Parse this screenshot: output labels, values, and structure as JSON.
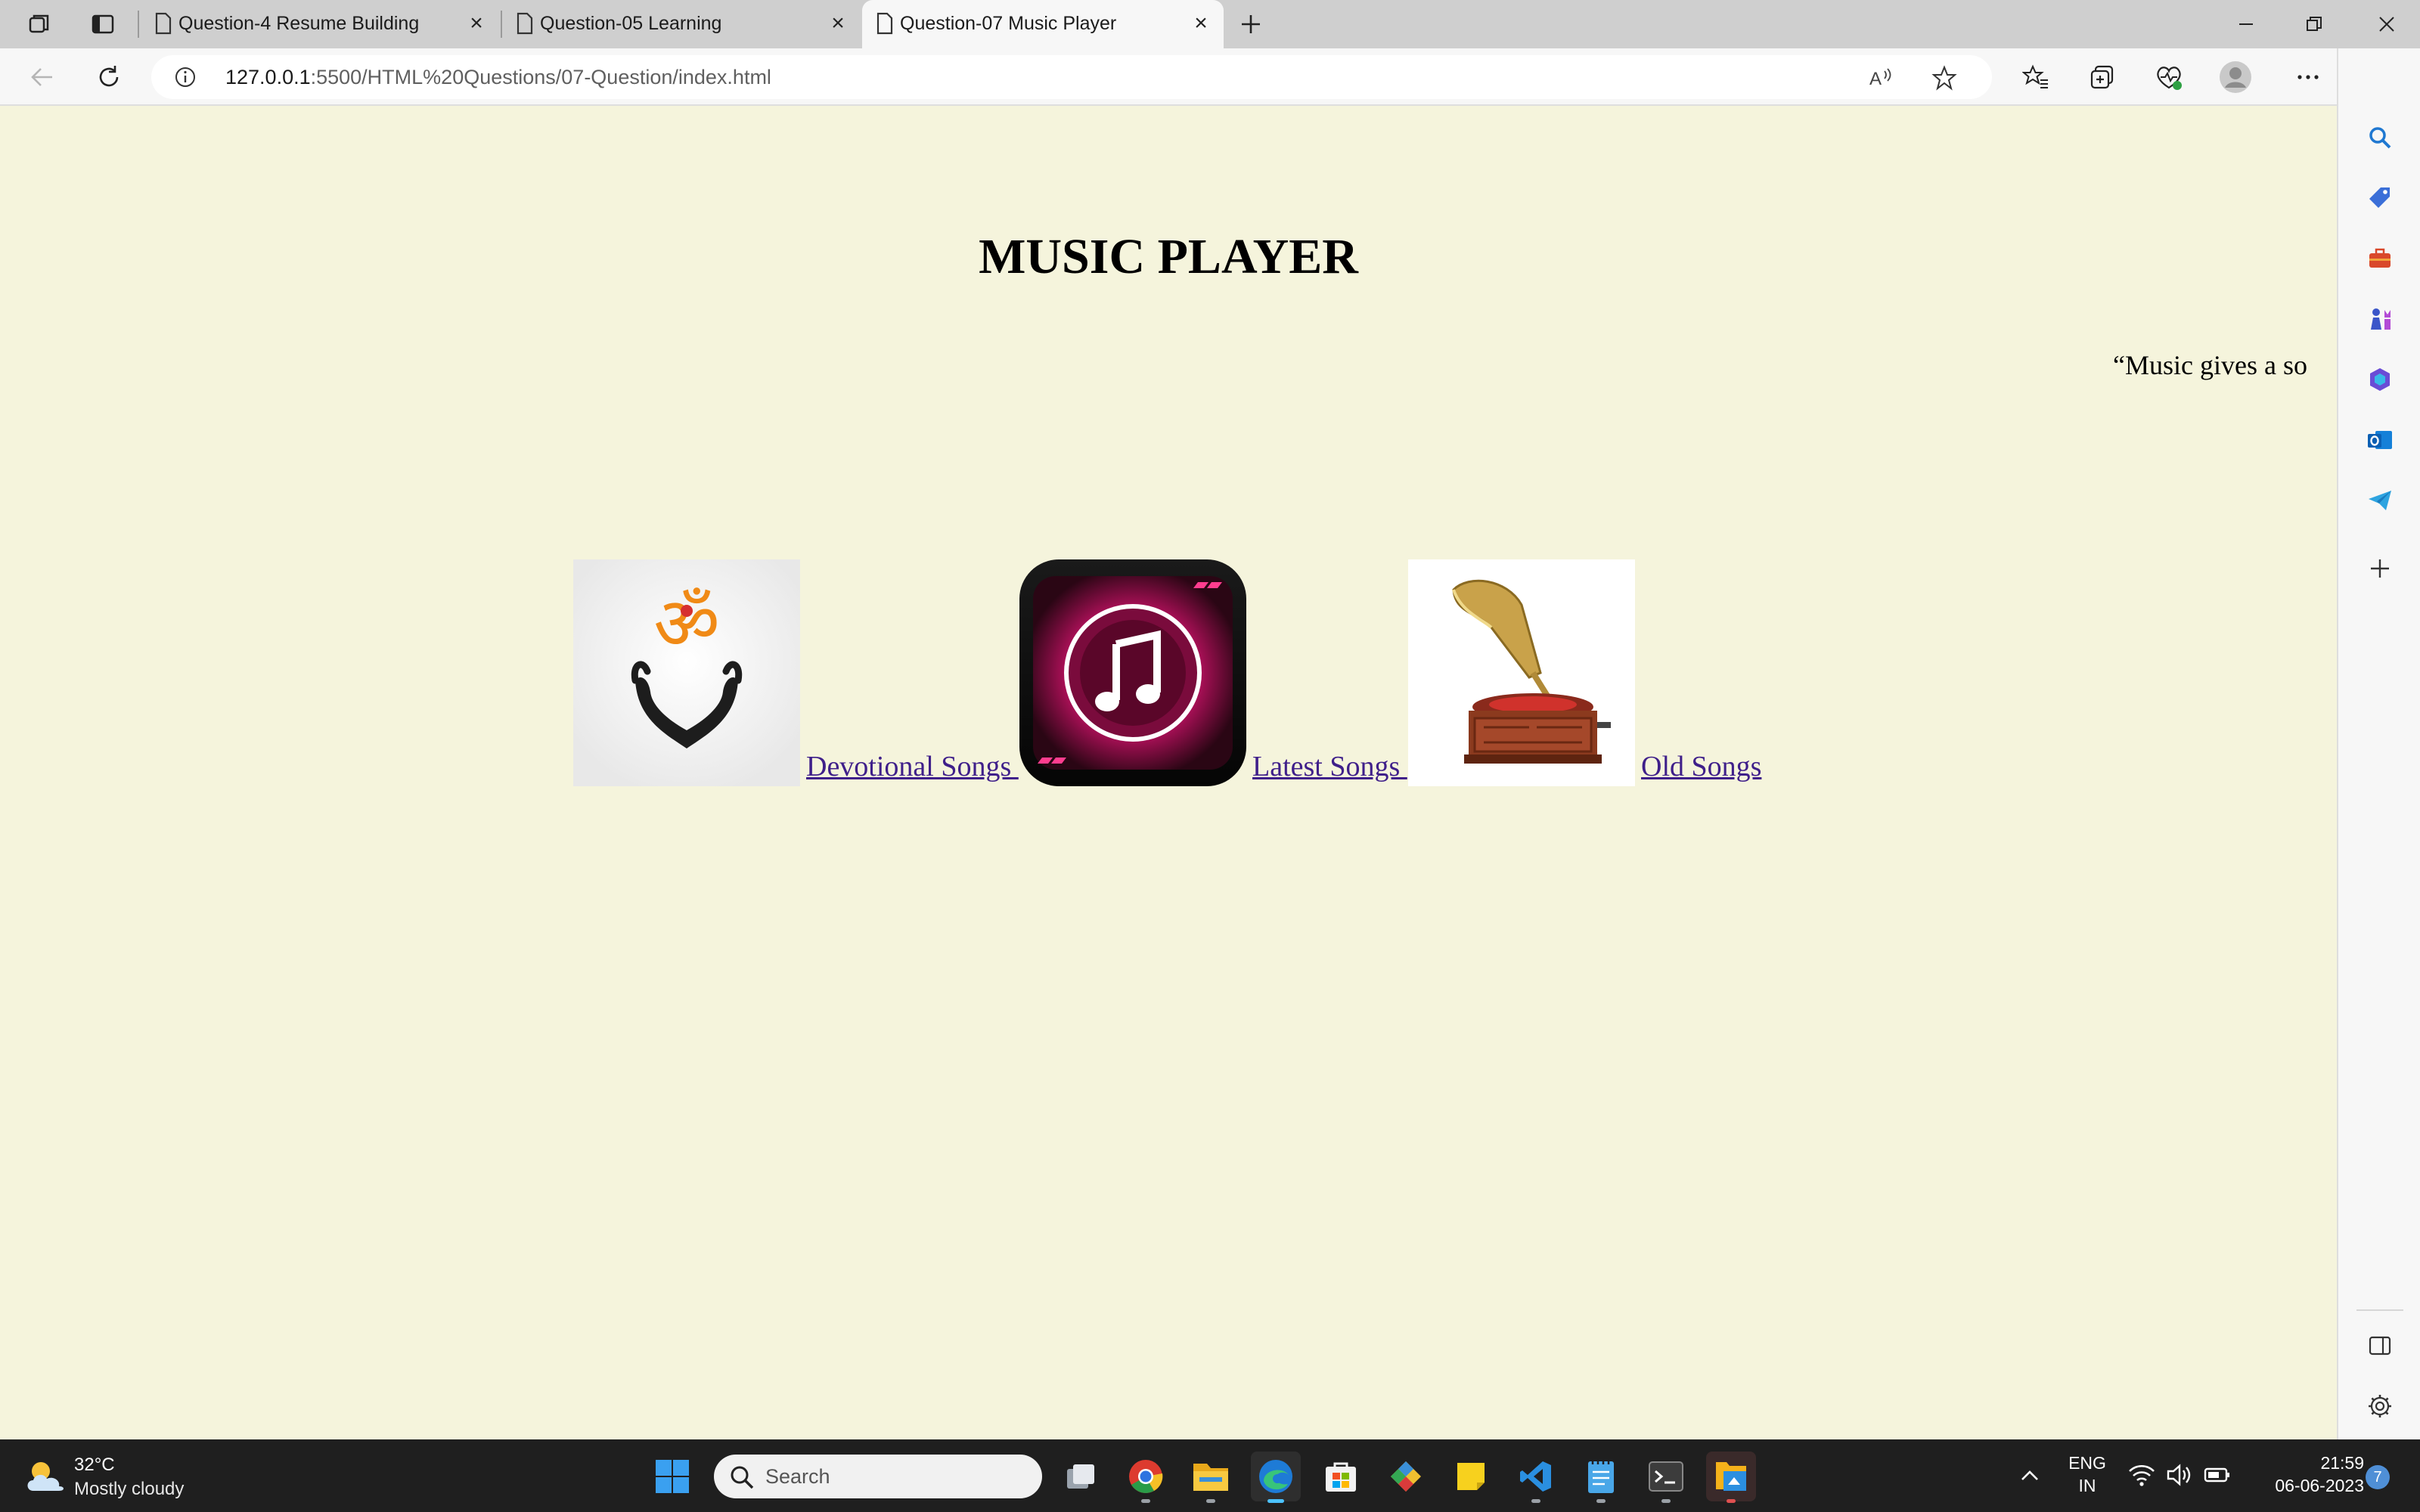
{
  "browser": {
    "tabs": [
      {
        "title": "Question-4 Resume Building"
      },
      {
        "title": "Question-05 Learning"
      },
      {
        "title": "Question-07 Music Player"
      }
    ],
    "address": {
      "host": "127.0.0.1",
      "rest": ":5500/HTML%20Questions/07-Question/index.html"
    }
  },
  "page": {
    "title": "MUSIC PLAYER",
    "marquee": "“Music gives a so",
    "songs": [
      {
        "label": "Devotional Songs ",
        "image": "om-hands-image"
      },
      {
        "label": "Latest Songs ",
        "image": "music-note-app-image"
      },
      {
        "label": "Old Songs",
        "image": "gramophone-image"
      }
    ]
  },
  "taskbar": {
    "weather_temp": "32°C",
    "weather_cond": "Mostly cloudy",
    "search_label": "Search",
    "lang_line1": "ENG",
    "lang_line2": "IN",
    "time": "21:59",
    "date": "06-06-2023",
    "notification_count": "7"
  },
  "colors": {
    "page_background": "#f5f4dc",
    "link": "#3f1f8a",
    "taskbar": "#1f1f1f"
  }
}
